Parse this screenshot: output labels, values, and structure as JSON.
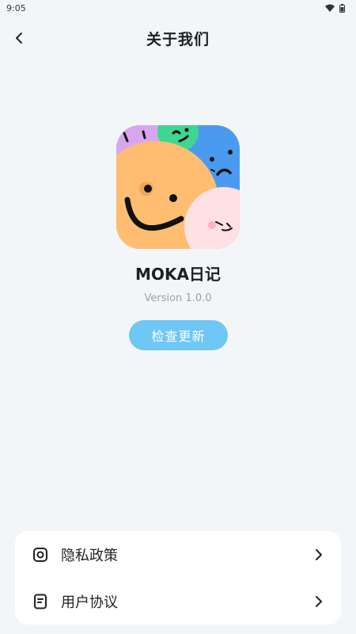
{
  "status": {
    "time": "9:05"
  },
  "header": {
    "title": "关于我们"
  },
  "app": {
    "name": "MOKA日记",
    "version": "Version 1.0.0",
    "update_label": "检查更新"
  },
  "menu": {
    "items": [
      {
        "label": "隐私政策",
        "icon": "privacy-icon"
      },
      {
        "label": "用户协议",
        "icon": "agreement-icon"
      }
    ]
  },
  "colors": {
    "background": "#f3f6f9",
    "accent": "#6ec7f5",
    "logo_orange": "#ffbd72",
    "logo_blue": "#4a9bf0",
    "logo_green": "#3ed690",
    "logo_purple": "#d8a6ef",
    "logo_pink": "#ffe0e3"
  }
}
